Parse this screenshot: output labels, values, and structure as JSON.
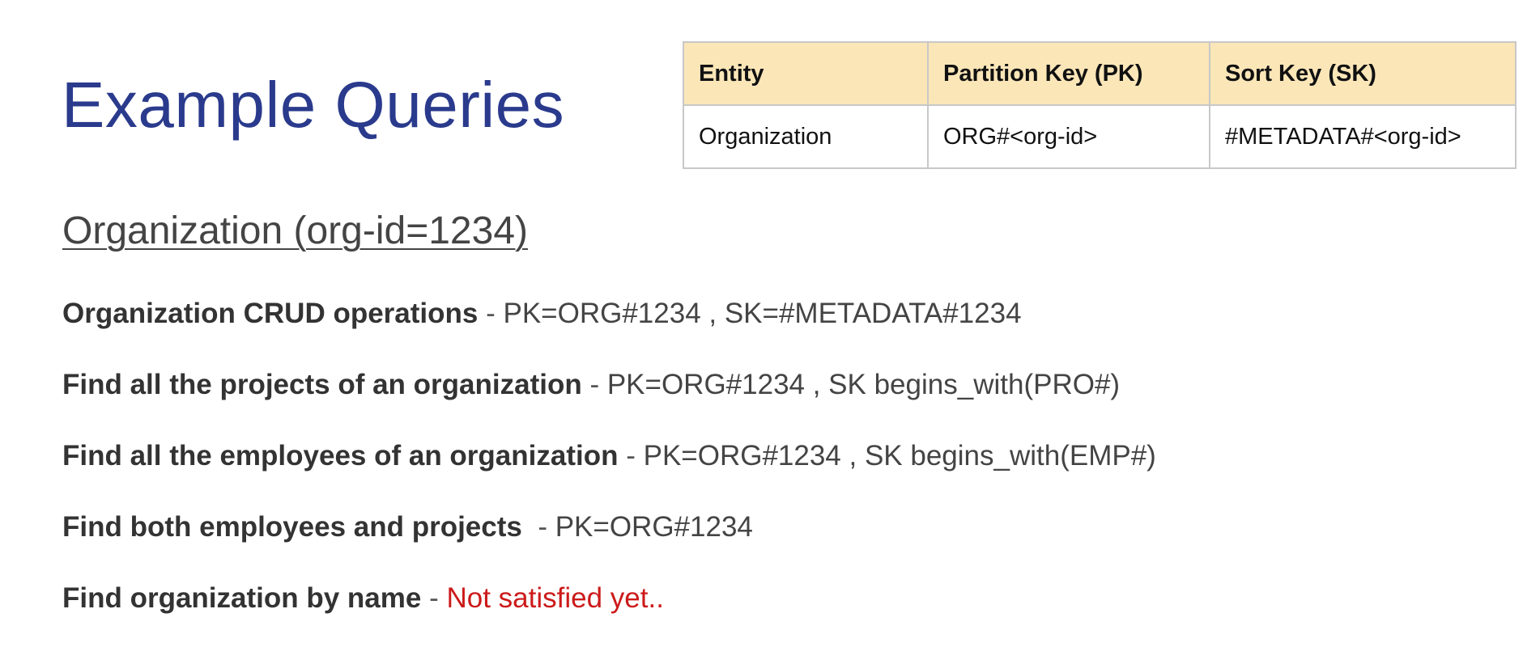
{
  "slide": {
    "title": "Example Queries",
    "table": {
      "headers": [
        "Entity",
        "Partition Key (PK)",
        "Sort Key (SK)"
      ],
      "rows": [
        [
          "Organization",
          "ORG#<org-id>",
          "#METADATA#<org-id>"
        ]
      ],
      "header_color": "#fbe6b8"
    },
    "section_heading": "Organization (org-id=1234)",
    "queries": [
      {
        "label": "Organization CRUD operations",
        "separator": " - ",
        "detail": "PK=ORG#1234 , SK=#METADATA#1234"
      },
      {
        "label": "Find all the projects of an organization",
        "separator": " - ",
        "detail": "PK=ORG#1234 , SK begins_with(PRO#)"
      },
      {
        "label": "Find all the employees of an organization",
        "separator": " - ",
        "detail": "PK=ORG#1234 , SK begins_with(EMP#)"
      },
      {
        "label": "Find both employees and projects",
        "separator": "  - ",
        "detail": "PK=ORG#1234"
      },
      {
        "label": "Find organization by name",
        "separator": " - ",
        "detail": "Not satisfied yet..",
        "detail_color": "#cc1a1a"
      }
    ],
    "colors": {
      "title": "#2a3a8c",
      "unsatisfied": "#cc1a1a"
    }
  }
}
